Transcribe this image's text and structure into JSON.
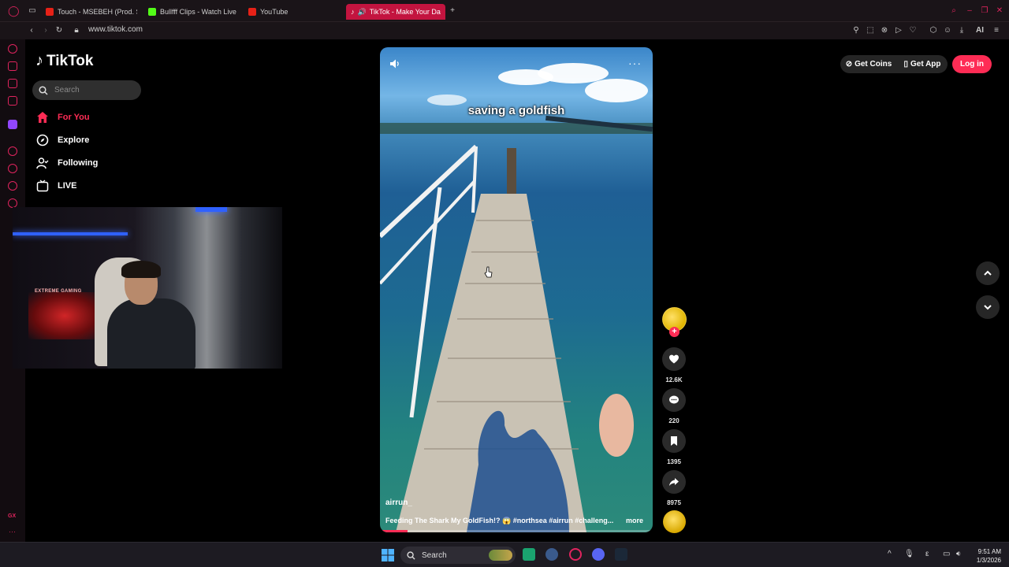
{
  "browser": {
    "tabs": [
      {
        "label": "Touch - MSEBEH (Prod. Sh",
        "icon_color": "#e62117"
      },
      {
        "label": "Bullfff Clips - Watch Live o",
        "icon_color": "#53fc18"
      },
      {
        "label": "YouTube",
        "icon_color": "#e62117"
      },
      {
        "label": "TikTok - Make Your Da",
        "icon_color": "#000000"
      }
    ],
    "url": "www.tiktok.com",
    "ai_label": "AI"
  },
  "tiktok": {
    "logo_text": "TikTok",
    "search_placeholder": "Search",
    "nav": [
      {
        "label": "For You",
        "icon": "home-icon"
      },
      {
        "label": "Explore",
        "icon": "compass-icon"
      },
      {
        "label": "Following",
        "icon": "user-follow-icon"
      },
      {
        "label": "LIVE",
        "icon": "live-tv-icon"
      }
    ],
    "accent_color": "#fe2c55",
    "top_buttons": {
      "get_coins": "Get Coins",
      "get_app": "Get App",
      "login": "Log in"
    },
    "video": {
      "overlay_caption": "saving a goldfish",
      "author": "airrun_",
      "description": "Feeding The Shark My GoldFish!? 😱 #northsea #airrun #challeng...",
      "more_label": "more",
      "progress_fraction": 0.1
    },
    "actions": {
      "likes": "12.6K",
      "comments": "220",
      "saves": "1395",
      "shares": "8975"
    }
  },
  "webcam": {
    "sign_text": "EXTREME GAMING"
  },
  "taskbar": {
    "search_label": "Search",
    "time": "9:51 AM",
    "date": "1/3/2026",
    "tray_lang": "ε"
  }
}
